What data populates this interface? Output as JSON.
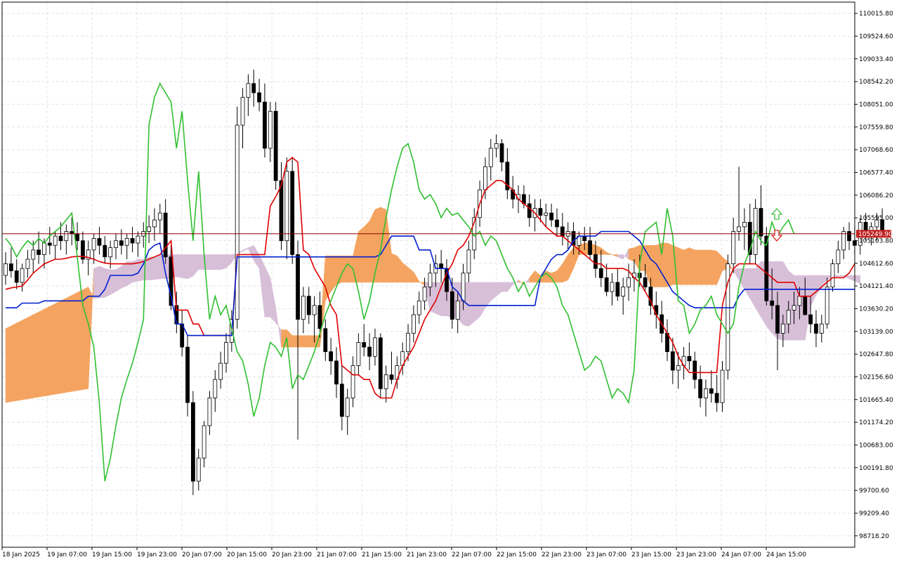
{
  "colors": {
    "background": "#ffffff",
    "grid": "#e4e4e4",
    "frame": "#000000",
    "candle_up": "#ffffff",
    "candle_down": "#000000",
    "tenkan": "#e00000",
    "kijun": "#0020d0",
    "chikou": "#30c030",
    "kumo_bull": "#f4a460",
    "kumo_bear": "#d8bfd8",
    "price_line": "#8b0000",
    "price_tag": "#c02020",
    "arrow_up": "#40c040",
    "arrow_down": "#e02020"
  },
  "chart_data": {
    "type": "candlestick",
    "title": "",
    "xlabel": "",
    "ylabel": "",
    "grid": true,
    "ylim": [
      98471.6,
      110260.2
    ],
    "y_ticks": [
      "110015.80",
      "109524.60",
      "109033.40",
      "108542.20",
      "108051.00",
      "107559.80",
      "107068.60",
      "106577.40",
      "106086.20",
      "105595.00",
      "105103.80",
      "104612.60",
      "104121.40",
      "103630.20",
      "103139.00",
      "102647.80",
      "102156.60",
      "101665.40",
      "101174.20",
      "100683.00",
      "100191.80",
      "99700.60",
      "99209.40",
      "98718.20"
    ],
    "x_ticks": [
      "18 Jan 2025",
      "19 Jan 07:00",
      "19 Jan 15:00",
      "19 Jan 23:00",
      "20 Jan 07:00",
      "20 Jan 15:00",
      "20 Jan 23:00",
      "21 Jan 07:00",
      "21 Jan 15:00",
      "21 Jan 23:00",
      "22 Jan 07:00",
      "22 Jan 15:00",
      "22 Jan 23:00",
      "23 Jan 07:00",
      "23 Jan 15:00",
      "23 Jan 23:00",
      "24 Jan 07:00",
      "24 Jan 15:00"
    ],
    "current_price": "105249.90",
    "current_price_value": 105249.9,
    "indicator": "Ichimoku Kinko Hyo",
    "ohlc": [
      [
        104350,
        104850,
        104150,
        104600
      ],
      [
        104600,
        104950,
        104300,
        104450
      ],
      [
        104450,
        104700,
        104050,
        104200
      ],
      [
        104200,
        104600,
        104000,
        104500
      ],
      [
        104500,
        104900,
        104300,
        104700
      ],
      [
        104700,
        105100,
        104400,
        104900
      ],
      [
        104900,
        105300,
        104600,
        104800
      ],
      [
        104800,
        105150,
        104500,
        105050
      ],
      [
        105050,
        105400,
        104800,
        105000
      ],
      [
        105000,
        105300,
        104700,
        105200
      ],
      [
        105200,
        105500,
        104900,
        105100
      ],
      [
        105100,
        105450,
        104800,
        105300
      ],
      [
        105300,
        105600,
        105000,
        105250
      ],
      [
        105250,
        105500,
        104900,
        105100
      ],
      [
        105100,
        105300,
        104600,
        104700
      ],
      [
        104700,
        105100,
        104350,
        104900
      ],
      [
        104900,
        105250,
        104600,
        105150
      ],
      [
        105150,
        105400,
        104800,
        105000
      ],
      [
        105000,
        105200,
        104600,
        104750
      ],
      [
        104750,
        105100,
        104500,
        104950
      ],
      [
        104950,
        105250,
        104700,
        105100
      ],
      [
        105100,
        105350,
        104800,
        105000
      ],
      [
        105000,
        105250,
        104700,
        105150
      ],
      [
        105150,
        105400,
        104850,
        105050
      ],
      [
        105050,
        105300,
        104750,
        105200
      ],
      [
        105200,
        105500,
        104950,
        105300
      ],
      [
        105300,
        105650,
        105050,
        105400
      ],
      [
        105400,
        105800,
        105100,
        105550
      ],
      [
        105550,
        105900,
        105250,
        105700
      ],
      [
        105700,
        106000,
        104600,
        104750
      ],
      [
        104750,
        105000,
        103600,
        103700
      ],
      [
        103700,
        104000,
        103100,
        103300
      ],
      [
        103300,
        103600,
        102600,
        102800
      ],
      [
        102800,
        103050,
        101300,
        101600
      ],
      [
        101600,
        101850,
        99600,
        99900
      ],
      [
        99900,
        100600,
        99700,
        100400
      ],
      [
        100400,
        101200,
        100200,
        101100
      ],
      [
        101100,
        101850,
        100900,
        101700
      ],
      [
        101700,
        102300,
        101400,
        102100
      ],
      [
        102100,
        102700,
        101900,
        102450
      ],
      [
        102450,
        103100,
        102250,
        102900
      ],
      [
        102900,
        103600,
        102700,
        103400
      ],
      [
        103400,
        108000,
        103200,
        107600
      ],
      [
        107600,
        108400,
        107100,
        108200
      ],
      [
        108200,
        108700,
        107800,
        108500
      ],
      [
        108500,
        108800,
        108000,
        108300
      ],
      [
        108300,
        108600,
        107900,
        108100
      ],
      [
        108100,
        108500,
        106900,
        107100
      ],
      [
        107100,
        108100,
        106800,
        107900
      ],
      [
        107900,
        108100,
        106200,
        106400
      ],
      [
        106400,
        106800,
        104900,
        105100
      ],
      [
        105100,
        106900,
        104700,
        106600
      ],
      [
        106600,
        106900,
        104600,
        104800
      ],
      [
        104800,
        105100,
        100800,
        103400
      ],
      [
        103400,
        104100,
        103100,
        103900
      ],
      [
        103900,
        104100,
        103300,
        103500
      ],
      [
        103500,
        103900,
        102900,
        103700
      ],
      [
        103700,
        104000,
        103000,
        103200
      ],
      [
        103200,
        103400,
        102500,
        102700
      ],
      [
        102700,
        103000,
        102200,
        102500
      ],
      [
        102500,
        102800,
        101700,
        102000
      ],
      [
        102000,
        102400,
        101000,
        101300
      ],
      [
        101300,
        101900,
        100900,
        101700
      ],
      [
        101700,
        102600,
        101500,
        102400
      ],
      [
        102400,
        103100,
        102200,
        102900
      ],
      [
        102900,
        103300,
        102600,
        102800
      ],
      [
        102800,
        103100,
        102300,
        102600
      ],
      [
        102600,
        103200,
        102400,
        103000
      ],
      [
        103000,
        103100,
        101700,
        101900
      ],
      [
        101900,
        102400,
        101600,
        102200
      ],
      [
        102200,
        102700,
        102000,
        102100
      ],
      [
        102100,
        102600,
        101900,
        102400
      ],
      [
        102400,
        102900,
        102200,
        102700
      ],
      [
        102700,
        103300,
        102500,
        103100
      ],
      [
        103100,
        103700,
        102900,
        103500
      ],
      [
        103500,
        104000,
        103300,
        103800
      ],
      [
        103800,
        104300,
        103600,
        104100
      ],
      [
        104100,
        104600,
        103900,
        104400
      ],
      [
        104400,
        104800,
        104100,
        104600
      ],
      [
        104600,
        104900,
        104200,
        104500
      ],
      [
        104500,
        104700,
        103800,
        104000
      ],
      [
        104000,
        104300,
        103200,
        103400
      ],
      [
        103400,
        104000,
        103100,
        103800
      ],
      [
        103800,
        104600,
        103600,
        104400
      ],
      [
        104400,
        105100,
        104200,
        104900
      ],
      [
        104900,
        105800,
        104700,
        105600
      ],
      [
        105600,
        106400,
        105400,
        106200
      ],
      [
        106200,
        106900,
        106000,
        106700
      ],
      [
        106700,
        107300,
        106400,
        107100
      ],
      [
        107100,
        107400,
        106900,
        107200
      ],
      [
        107200,
        107300,
        106600,
        106800
      ],
      [
        106800,
        107100,
        106000,
        106200
      ],
      [
        106200,
        106500,
        105800,
        106000
      ],
      [
        106000,
        106300,
        105700,
        106100
      ],
      [
        106100,
        106300,
        105800,
        105900
      ],
      [
        105900,
        106100,
        105400,
        105600
      ],
      [
        105600,
        106000,
        105300,
        105800
      ],
      [
        105800,
        106000,
        105500,
        105650
      ],
      [
        105650,
        105900,
        105400,
        105700
      ],
      [
        105700,
        105900,
        105400,
        105550
      ],
      [
        105550,
        105800,
        105200,
        105400
      ],
      [
        105400,
        105700,
        105000,
        105200
      ],
      [
        105200,
        105500,
        104900,
        105300
      ],
      [
        105300,
        105500,
        104800,
        105000
      ],
      [
        105000,
        105300,
        104800,
        105200
      ],
      [
        105200,
        105400,
        104900,
        105100
      ],
      [
        105100,
        105400,
        104700,
        104800
      ],
      [
        104800,
        105100,
        104300,
        104500
      ],
      [
        104500,
        104900,
        104100,
        104300
      ],
      [
        104300,
        104600,
        103900,
        104000
      ],
      [
        104000,
        104400,
        103700,
        104200
      ],
      [
        104200,
        104500,
        103800,
        103900
      ],
      [
        103900,
        104300,
        103500,
        104100
      ],
      [
        104100,
        104600,
        103800,
        104300
      ],
      [
        104300,
        104700,
        104000,
        104400
      ],
      [
        104400,
        104800,
        104100,
        104300
      ],
      [
        104300,
        104600,
        104000,
        104100
      ],
      [
        104100,
        104300,
        103500,
        103700
      ],
      [
        103700,
        104000,
        103200,
        103500
      ],
      [
        103500,
        103800,
        102900,
        103100
      ],
      [
        103100,
        103400,
        102500,
        102700
      ],
      [
        102700,
        103000,
        102000,
        102300
      ],
      [
        102300,
        102700,
        101900,
        102400
      ],
      [
        102400,
        102800,
        102100,
        102600
      ],
      [
        102600,
        102900,
        102300,
        102500
      ],
      [
        102500,
        102700,
        101900,
        102100
      ],
      [
        102100,
        102400,
        101500,
        101700
      ],
      [
        101700,
        102100,
        101300,
        101900
      ],
      [
        101900,
        102300,
        101600,
        101800
      ],
      [
        101800,
        102200,
        101400,
        101600
      ],
      [
        101600,
        102500,
        101400,
        102300
      ],
      [
        102300,
        104800,
        102100,
        104600
      ],
      [
        104600,
        105600,
        104400,
        105300
      ],
      [
        105300,
        106700,
        105100,
        105400
      ],
      [
        105400,
        105800,
        104900,
        105500
      ],
      [
        105500,
        105900,
        104600,
        104800
      ],
      [
        104800,
        106000,
        104600,
        105800
      ],
      [
        105800,
        106300,
        105000,
        105200
      ],
      [
        105200,
        105400,
        103700,
        103800
      ],
      [
        103800,
        104500,
        103400,
        103700
      ],
      [
        103700,
        104000,
        102300,
        103100
      ],
      [
        103100,
        103500,
        102800,
        103300
      ],
      [
        103300,
        103800,
        103100,
        103600
      ],
      [
        103600,
        104000,
        103300,
        103700
      ],
      [
        103700,
        104100,
        103400,
        103900
      ],
      [
        103900,
        104300,
        103600,
        103500
      ],
      [
        103500,
        103900,
        103100,
        103300
      ],
      [
        103300,
        103600,
        102800,
        103100
      ],
      [
        103100,
        103500,
        102900,
        103300
      ],
      [
        103300,
        104300,
        103200,
        104100
      ],
      [
        104100,
        104700,
        104000,
        104600
      ],
      [
        104600,
        105100,
        104400,
        104900
      ],
      [
        104900,
        105400,
        104700,
        105300
      ],
      [
        105300,
        105500,
        104900,
        105100
      ],
      [
        105100,
        105400,
        104800,
        105000
      ],
      [
        105000,
        105600,
        104800,
        105500
      ],
      [
        105500,
        105700,
        105100,
        105200
      ],
      [
        105200,
        105500,
        105000,
        105400
      ],
      [
        105400,
        105700,
        105100,
        105550
      ],
      [
        105550,
        105800,
        105300,
        105250
      ]
    ],
    "tenkan_sen": [
      104050,
      104080,
      104100,
      104120,
      104250,
      104400,
      104500,
      104600,
      104650,
      104700,
      104700,
      104720,
      104750,
      104760,
      104760,
      104740,
      104700,
      104650,
      104620,
      104600,
      104600,
      104600,
      104600,
      104600,
      104620,
      104650,
      104700,
      104750,
      104800,
      104950,
      105100,
      103600,
      103600,
      103600,
      103300,
      103300,
      103050,
      103050,
      103050,
      103050,
      103050,
      103050,
      104800,
      104800,
      104800,
      104800,
      104800,
      104800,
      105850,
      106050,
      106300,
      106800,
      106900,
      106800,
      104900,
      104800,
      104500,
      104300,
      104100,
      103700,
      103500,
      102400,
      102300,
      102200,
      102200,
      102100,
      102100,
      101800,
      101700,
      101700,
      101700,
      102100,
      102400,
      102600,
      102800,
      103100,
      103400,
      103600,
      103800,
      104100,
      104400,
      104600,
      104900,
      105000,
      105200,
      105500,
      105900,
      106200,
      106300,
      106400,
      106400,
      106300,
      106200,
      106000,
      105900,
      105800,
      105700,
      105550,
      105400,
      105300,
      105200,
      105200,
      105100,
      105000,
      104900,
      104800,
      104700,
      104600,
      104600,
      104500,
      104500,
      104500,
      104500,
      104450,
      104300,
      104200,
      104000,
      103800,
      103500,
      103300,
      103100,
      102900,
      102600,
      102400,
      102250,
      102250,
      102250,
      102250,
      102250,
      102250,
      103700,
      104200,
      104500,
      104600,
      104600,
      104600,
      104600,
      104500,
      104400,
      104300,
      104200,
      104200,
      104200,
      104200,
      103900,
      103900,
      103900,
      104000,
      104100,
      104200,
      104300,
      104300,
      104300,
      104400,
      104600,
      104900,
      105200
    ],
    "kijun_sen": [
      103650,
      103650,
      103650,
      103750,
      103750,
      103750,
      103750,
      103800,
      103800,
      103800,
      103800,
      103800,
      103800,
      103800,
      103800,
      103900,
      103900,
      103900,
      104050,
      104350,
      104350,
      104350,
      104350,
      104350,
      104400,
      104600,
      104900,
      105000,
      105050,
      104400,
      103900,
      103300,
      103300,
      103050,
      103050,
      103050,
      103050,
      103050,
      103050,
      103050,
      103050,
      103050,
      104750,
      104750,
      104750,
      104750,
      104750,
      104750,
      104750,
      104750,
      104750,
      104750,
      104750,
      104750,
      104750,
      104750,
      104750,
      104750,
      104750,
      104750,
      104750,
      104750,
      104750,
      104750,
      104750,
      104750,
      104750,
      104750,
      104800,
      105000,
      105200,
      105200,
      105200,
      105200,
      105200,
      104900,
      104900,
      104900,
      104500,
      104500,
      104500,
      104100,
      104000,
      103800,
      103700,
      103700,
      103700,
      103700,
      103700,
      103700,
      103700,
      103700,
      103700,
      103700,
      103700,
      103700,
      103700,
      104300,
      104500,
      104700,
      104800,
      104800,
      104900,
      105100,
      105200,
      105200,
      105200,
      105200,
      105300,
      105300,
      105300,
      105300,
      105300,
      105300,
      105200,
      105100,
      104900,
      104700,
      104600,
      104400,
      104200,
      104000,
      103900,
      103800,
      103700,
      103650,
      103650,
      103650,
      103650,
      103650,
      103650,
      103650,
      103650,
      103900,
      104050,
      104050,
      104050,
      104050,
      104050,
      104050,
      104050,
      104050,
      104050,
      104050,
      104050,
      104050,
      104050,
      104050,
      104050,
      104050,
      104050,
      104050,
      104050,
      104050,
      104050,
      104050,
      104050,
      104100,
      104100,
      104100
    ]
  }
}
